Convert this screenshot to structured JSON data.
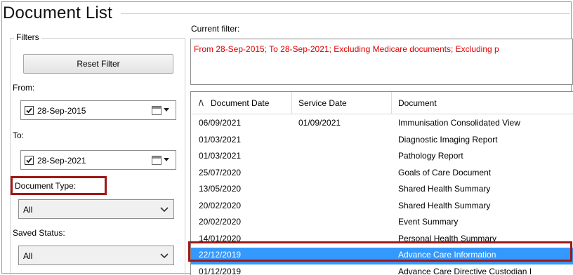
{
  "title": "Document List",
  "filters": {
    "legend": "Filters",
    "reset_button": "Reset Filter",
    "from_label": "From:",
    "from_date": "28-Sep-2015",
    "to_label": "To:",
    "to_date": "28-Sep-2021",
    "document_type_label": "Document Type:",
    "document_type_value": "All",
    "saved_status_label": "Saved Status:",
    "saved_status_value": "All"
  },
  "current_filter": {
    "label": "Current filter:",
    "text": "From 28-Sep-2015; To 28-Sep-2021; Excluding Medicare documents; Excluding p"
  },
  "grid": {
    "columns": [
      "Document Date",
      "Service Date",
      "Document"
    ],
    "sort_indicator": "/\\",
    "rows": [
      {
        "document_date": "06/09/2021",
        "service_date": "01/09/2021",
        "document": "Immunisation Consolidated View"
      },
      {
        "document_date": "01/03/2021",
        "service_date": "",
        "document": "Diagnostic Imaging Report"
      },
      {
        "document_date": "01/03/2021",
        "service_date": "",
        "document": "Pathology Report"
      },
      {
        "document_date": "25/07/2020",
        "service_date": "",
        "document": "Goals of Care Document"
      },
      {
        "document_date": "13/05/2020",
        "service_date": "",
        "document": "Shared Health Summary"
      },
      {
        "document_date": "20/02/2020",
        "service_date": "",
        "document": "Shared Health Summary"
      },
      {
        "document_date": "20/02/2020",
        "service_date": "",
        "document": "Event Summary"
      },
      {
        "document_date": "14/01/2020",
        "service_date": "",
        "document": "Personal Health Summary"
      },
      {
        "document_date": "22/12/2019",
        "service_date": "",
        "document": "Advance Care Information"
      },
      {
        "document_date": "01/12/2019",
        "service_date": "",
        "document": "Advance Care Directive Custodian I"
      }
    ],
    "selected_row": 8
  },
  "colors": {
    "highlight_box": "#a01818",
    "selection": "#3399ff",
    "filter_text": "#e00000"
  }
}
